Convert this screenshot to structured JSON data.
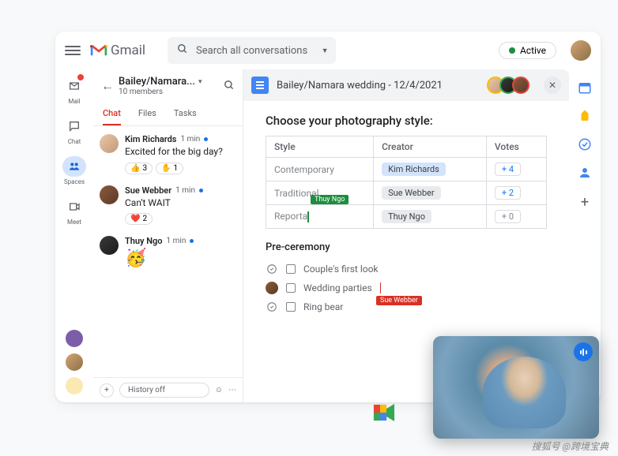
{
  "header": {
    "product": "Gmail",
    "search_placeholder": "Search all conversations",
    "status": "Active"
  },
  "nav": {
    "mail": "Mail",
    "chat": "Chat",
    "spaces": "Spaces",
    "meet": "Meet"
  },
  "chat": {
    "title": "Bailey/Namara...",
    "subtitle": "10 members",
    "tabs": {
      "chat": "Chat",
      "files": "Files",
      "tasks": "Tasks"
    },
    "messages": [
      {
        "name": "Kim Richards",
        "time": "1 min",
        "text": "Excited for the big day?",
        "reactions": [
          {
            "emoji": "👍",
            "count": "3"
          },
          {
            "emoji": "✋",
            "count": "1"
          }
        ]
      },
      {
        "name": "Sue Webber",
        "time": "1 min",
        "text": "Can't WAIT",
        "reactions": [
          {
            "emoji": "❤️",
            "count": "2"
          }
        ]
      },
      {
        "name": "Thuy Ngo",
        "time": "1 min",
        "emoji": "🥳"
      }
    ],
    "compose": "History off"
  },
  "doc": {
    "title": "Bailey/Namara wedding - 12/4/2021",
    "heading": "Choose your photography style:",
    "table": {
      "headers": {
        "style": "Style",
        "creator": "Creator",
        "votes": "Votes"
      },
      "rows": [
        {
          "style": "Contemporary",
          "creator": "Kim Richards",
          "votes": "4"
        },
        {
          "style": "Traditional",
          "creator": "Sue Webber",
          "votes": "2"
        },
        {
          "style": "Reporta",
          "creator": "Thuy Ngo",
          "votes": "0"
        }
      ]
    },
    "collab": {
      "thuy": "Thuy Ngo",
      "sue": "Sue Webber"
    },
    "section": "Pre-ceremony",
    "checklist": [
      "Couple's first look",
      "Wedding parties",
      "Ring bear"
    ]
  },
  "colors": {
    "blue": "#1a73e8",
    "red": "#ea4335",
    "green": "#34a853",
    "yellow": "#fbbc04"
  },
  "watermark": "搜狐号 @跨境宝典"
}
